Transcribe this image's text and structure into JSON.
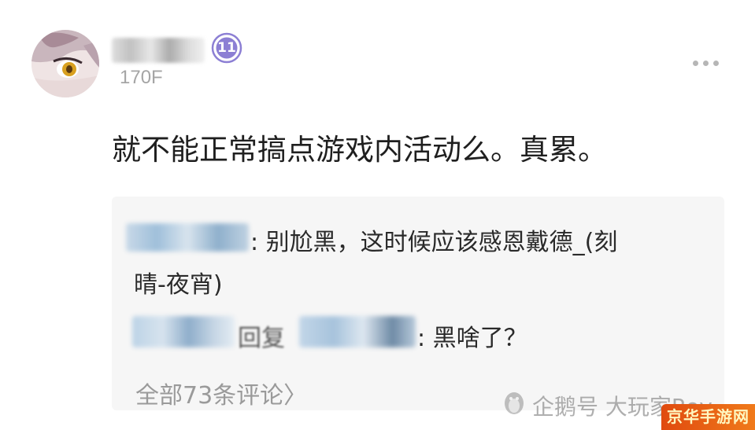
{
  "post": {
    "floor": "170F",
    "level": "11",
    "text": "就不能正常搞点游戏内活动么。真累。"
  },
  "comments": {
    "first": {
      "text_line1": ": 别尬黑，这时候应该感恩戴德_(刻",
      "text_line2": "晴-夜宵)"
    },
    "reply": {
      "verb": "回复",
      "text": ": 黑啥了？"
    },
    "all_comments_label": "全部73条评论〉"
  },
  "watermark": {
    "text": "企鹅号 大玩家Roy",
    "icon": "penguin-icon"
  },
  "site_badge": {
    "text": "京华手游网"
  },
  "colors": {
    "level_badge": "#8c7fd4",
    "reply_link": "#5b7fb0",
    "floor_text": "#a5a5a5",
    "comment_bg": "#f6f6f6",
    "site_badge": "#e8621a"
  }
}
